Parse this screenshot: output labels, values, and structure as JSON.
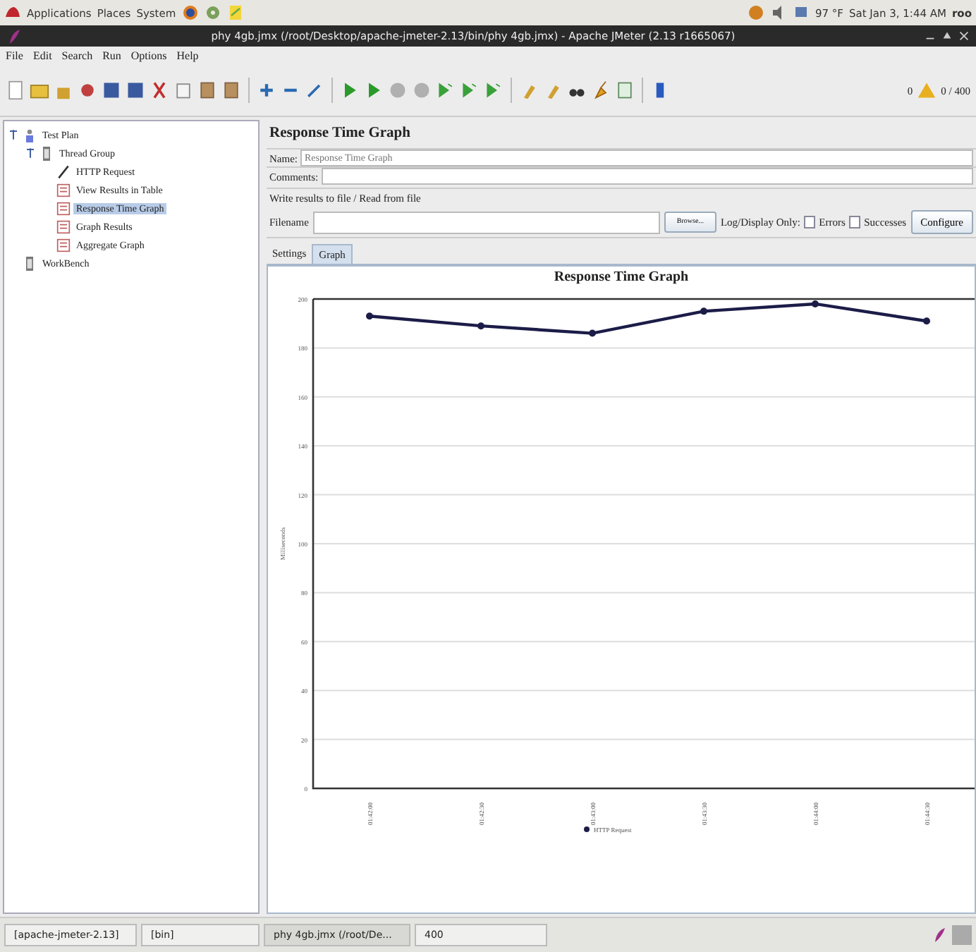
{
  "top_panel": {
    "menus": [
      "Applications",
      "Places",
      "System"
    ],
    "weather": "97 °F",
    "clock": "Sat Jan 3,  1:44 AM",
    "user": "roo"
  },
  "window": {
    "title": "phy 4gb.jmx (/root/Desktop/apache-jmeter-2.13/bin/phy 4gb.jmx) - Apache JMeter (2.13 r1665067)"
  },
  "menu": [
    "File",
    "Edit",
    "Search",
    "Run",
    "Options",
    "Help"
  ],
  "toolbar": {
    "warnings": "0",
    "threads": "0 / 400"
  },
  "tree": [
    {
      "label": "Test Plan",
      "kind": "plan",
      "selected": false,
      "expanded": true,
      "children": [
        {
          "label": "Thread Group",
          "kind": "group",
          "selected": false,
          "expanded": true,
          "children": [
            {
              "label": "HTTP Request",
              "kind": "sampler",
              "selected": false
            },
            {
              "label": "View Results in Table",
              "kind": "listener",
              "selected": false
            },
            {
              "label": "Response Time Graph",
              "kind": "listener",
              "selected": true
            },
            {
              "label": "Graph Results",
              "kind": "listener",
              "selected": false
            },
            {
              "label": "Aggregate Graph",
              "kind": "listener",
              "selected": false
            }
          ]
        }
      ]
    },
    {
      "label": "WorkBench",
      "kind": "group",
      "selected": false
    }
  ],
  "panel": {
    "heading": "Response Time Graph",
    "name_label": "Name:",
    "name_value": "Response Time Graph",
    "comments_label": "Comments:",
    "file_section": "Write results to file / Read from file",
    "filename_label": "Filename",
    "browse": "Browse...",
    "log_label": "Log/Display Only:",
    "errors": {
      "label": "Errors",
      "checked": false
    },
    "successes": {
      "label": "Successes",
      "checked": false
    },
    "configure": "Configure",
    "tabs": [
      {
        "label": "Settings",
        "selected": false
      },
      {
        "label": "Graph",
        "selected": true
      }
    ],
    "chart_data": {
      "type": "line",
      "title": "Response Time Graph",
      "ylabel": "Milliseconds",
      "categories": [
        "01:42:00",
        "01:42:30",
        "01:43:00",
        "01:43:30",
        "01:44:00",
        "01:44:30"
      ],
      "series": [
        {
          "name": "HTTP Request",
          "color": "#1c1c48",
          "marker": "circle",
          "values": [
            193,
            189,
            186,
            195,
            198,
            191
          ]
        }
      ],
      "grid": true,
      "ylim": [
        0,
        200
      ],
      "yticks": [
        0,
        20,
        40,
        60,
        80,
        100,
        120,
        140,
        160,
        180,
        200
      ]
    }
  },
  "taskbar": [
    "[apache-jmeter-2.13]",
    "[bin]",
    "phy 4gb.jmx (/root/De...",
    "400"
  ]
}
